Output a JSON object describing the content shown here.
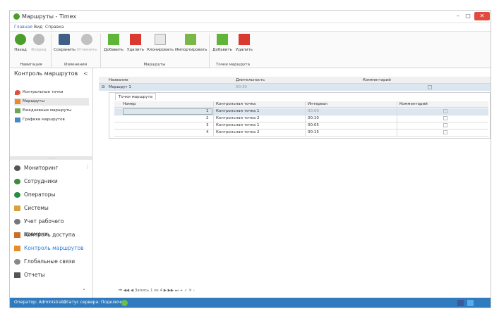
{
  "window": {
    "title": "Маршруты - Timex",
    "minimize": "–",
    "maximize": "□",
    "close": "✕"
  },
  "menu": {
    "items": [
      "Главная",
      "Вид",
      "Справка"
    ]
  },
  "ribbon": {
    "buttons": [
      "Назад",
      "Вперед",
      "Сохранить",
      "Отменить",
      "Добавить",
      "Удалить",
      "Клонировать",
      "Импортировать",
      "Добавить",
      "Удалить"
    ],
    "groups": [
      "Навигация",
      "Изменения",
      "Маршруты",
      "Точки маршрута"
    ]
  },
  "sidebar": {
    "header": "Контроль маршрутов",
    "collapse": "<",
    "items": [
      "Контрольные точки",
      "Маршруты",
      "Ежедневные маршруты",
      "Графики маршрутов"
    ],
    "splitter": "......",
    "modules": [
      "Мониторинг",
      "Сотрудники",
      "Операторы",
      "Системы",
      "Учет рабочего времени",
      "Контроль доступа",
      "Контроль маршрутов",
      "Глобальные связи",
      "Отчеты"
    ],
    "more": "⋮",
    "expand": "⌄"
  },
  "grid": {
    "columns": [
      "Название",
      "Длительность",
      "Комментарий"
    ],
    "row": {
      "name": "Маршрут 1",
      "duration": "00:30",
      "expander": "⊟"
    },
    "tab": "Точки маршрута",
    "sub_columns": [
      "Номер",
      "Контрольная точка",
      "Интервал",
      "Комментарий"
    ],
    "sub_rows": [
      {
        "num": "1",
        "point": "Контрольная точка 1",
        "interval": "00:00"
      },
      {
        "num": "2",
        "point": "Контрольная точка 2",
        "interval": "00:10"
      },
      {
        "num": "3",
        "point": "Контрольная точка 1",
        "interval": "00:05"
      },
      {
        "num": "4",
        "point": "Контрольная точка 2",
        "interval": "00:15"
      }
    ],
    "pager": "⏮ ◀◀ ◀ Запись 1 из 4 ▶ ▶▶ ⏭ + ✓ ✕ ‹"
  },
  "status": {
    "operator": "Оператор: Administrator",
    "server": "Статус сервера: Подключен"
  },
  "colors": {
    "accent": "#2f7bbd",
    "selected_row": "#dce6f0",
    "close": "#e24a3f"
  }
}
